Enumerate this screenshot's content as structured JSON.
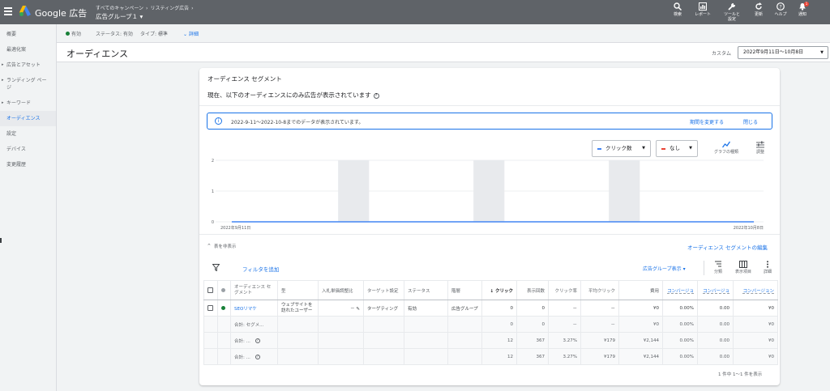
{
  "app": {
    "brand": "Google 広告",
    "breadcrumb": [
      "すべてのキャンペーン",
      "リスティング広告"
    ],
    "adgroup": "広告グループ１",
    "adgroup_caret": "▾"
  },
  "toolbar": {
    "items": [
      {
        "label": "検索",
        "icon": "search-icon"
      },
      {
        "label": "レポート",
        "icon": "report-icon"
      },
      {
        "label": "ツールと",
        "label2": "設定",
        "icon": "wrench-icon"
      },
      {
        "label": "更新",
        "icon": "refresh-icon"
      },
      {
        "label": "ヘルプ",
        "icon": "help-icon"
      },
      {
        "label": "通知",
        "icon": "bell-icon",
        "badge": "1"
      }
    ]
  },
  "nav": {
    "items": [
      {
        "label": "概要"
      },
      {
        "label": "最適化案"
      },
      {
        "label": "広告とアセット"
      },
      {
        "label": "ランディング ペー",
        "label2": "ジ"
      },
      {
        "label": "キーワード"
      },
      {
        "label": "オーディエンス"
      },
      {
        "label": "設定"
      },
      {
        "label": "デバイス"
      },
      {
        "label": "変更履歴"
      }
    ]
  },
  "status": {
    "state": "有効",
    "status_text": "ステータス: 有効",
    "type_text": "タイプ: 標準",
    "details": "詳細"
  },
  "page": {
    "title": "オーディエンス",
    "date_label": "カスタム",
    "date_range": "2022年9月11日～10月8日"
  },
  "card": {
    "title": "オーディエンス セグメント",
    "subtitle": "現在、以下のオーディエンスにのみ広告が表示されています",
    "info": "2022-9-11～2022-10-8までのデータが表示されています。",
    "info_link1": "期間を変更する",
    "info_link2": "閉じる",
    "metric1": "クリック数",
    "metric2": "なし",
    "chart_btn1": "グラフの種類",
    "chart_btn2": "調整",
    "toggle": "表を非表示",
    "edit_link": "オーディエンス セグメントの編集",
    "add_filter": "フィルタを追加",
    "group_view": "広告グループ表示",
    "tbtn_split": "分類",
    "tbtn_cols": "表示項目",
    "tbtn_more": "詳細",
    "pager": "1 件中 1～1 件を表示"
  },
  "colors": {
    "metric1": "#4285f4",
    "metric2": "#ea4335",
    "link": "#1a73e8",
    "enabled": "#188038",
    "bar": "#e8eaed"
  },
  "chart_data": {
    "type": "bar",
    "series": [
      {
        "values": [
          0,
          0,
          0,
          0,
          0,
          0,
          0,
          0,
          0,
          0,
          0,
          0,
          0,
          0,
          0,
          0,
          0,
          0,
          0,
          0,
          0,
          0,
          0,
          0,
          0,
          0,
          0,
          0
        ]
      }
    ],
    "y_ticks": [
      "2",
      "1",
      "0"
    ],
    "ylim": [
      0,
      2
    ],
    "x_start_label": "2022年9月11日",
    "x_end_label": "2022年10月8日",
    "weekend_bands": 3
  },
  "table": {
    "headers": [
      "オーディエンス セグメント",
      "型",
      "入札単価調整比",
      "ターゲット設定",
      "ステータス",
      "階層",
      "クリック",
      "表示回数",
      "クリック率",
      "平均クリック",
      "費用",
      "コンバージョ",
      "コンバージョ",
      "コンバージョン"
    ],
    "rows": [
      {
        "name": "SEOリマケ",
        "type": "ウェブサイトを 訪れたユーザー",
        "bid": "－",
        "targeting": "ターゲティング",
        "status": "有効",
        "level": "広告グループ",
        "clicks": "0",
        "impr": "0",
        "ctr": "－",
        "cpc": "－",
        "cost": "¥0",
        "c1": "0.00%",
        "c2": "0.00",
        "c3": "¥0"
      }
    ],
    "totals": [
      {
        "name": "合計: セグメ...",
        "clicks": "0",
        "impr": "0",
        "ctr": "－",
        "cpc": "－",
        "cost": "¥0",
        "c1": "0.00%",
        "c2": "0.00",
        "c3": "¥0"
      },
      {
        "name": "合計: ...",
        "clicks": "12",
        "impr": "367",
        "ctr": "3.27%",
        "cpc": "¥179",
        "cost": "¥2,144",
        "c1": "0.00%",
        "c2": "0.00",
        "c3": "¥0"
      },
      {
        "name": "合計: ...",
        "clicks": "12",
        "impr": "367",
        "ctr": "3.27%",
        "cpc": "¥179",
        "cost": "¥2,144",
        "c1": "0.00%",
        "c2": "0.00",
        "c3": "¥0"
      }
    ]
  }
}
